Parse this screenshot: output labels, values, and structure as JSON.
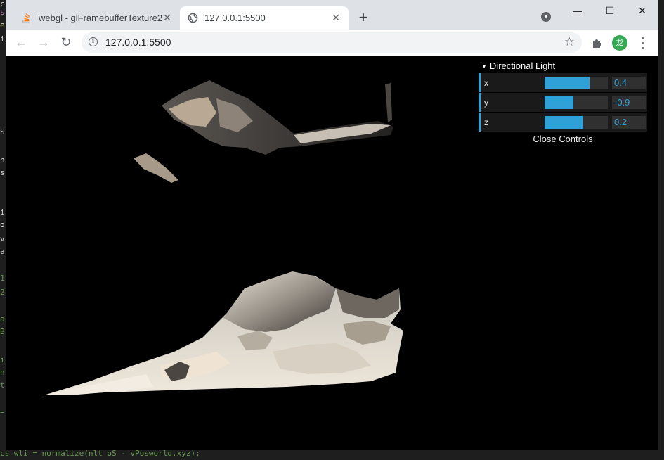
{
  "tabs": [
    {
      "title": "webgl - glFramebufferTexture2",
      "icon": "stack-overflow-icon",
      "active": false
    },
    {
      "title": "127.0.0.1:5500",
      "icon": "globe-icon",
      "active": true
    }
  ],
  "window_controls": {
    "minimize": "—",
    "maximize": "☐",
    "close": "✕"
  },
  "toolbar": {
    "url": "127.0.0.1:5500",
    "profile_initial": "龙"
  },
  "gui": {
    "folder_title": "Directional Light",
    "controls": [
      {
        "label": "x",
        "value": "0.4",
        "fraction": 0.7
      },
      {
        "label": "y",
        "value": "-0.9",
        "fraction": 0.45
      },
      {
        "label": "z",
        "value": "0.2",
        "fraction": 0.6
      }
    ],
    "close_label": "Close Controls"
  },
  "editor_letters": [
    {
      "ch": "c",
      "color": "#d4d4d4"
    },
    {
      "ch": "s",
      "color": "#c586c0"
    },
    {
      "ch": "e",
      "color": "#dcdcaa"
    },
    {
      "ch": "i",
      "color": "#d4d4d4"
    },
    {
      "ch": "S",
      "color": "#d4d4d4"
    },
    {
      "ch": "n",
      "color": "#d4d4d4"
    },
    {
      "ch": "s",
      "color": "#d4d4d4"
    },
    {
      "ch": "i",
      "color": "#d4d4d4"
    },
    {
      "ch": "o",
      "color": "#d4d4d4"
    },
    {
      "ch": "v",
      "color": "#d4d4d4"
    },
    {
      "ch": "a",
      "color": "#d4d4d4"
    },
    {
      "ch": "1",
      "color": "#6a9955"
    },
    {
      "ch": "2",
      "color": "#6a9955"
    },
    {
      "ch": "a",
      "color": "#6a9955"
    },
    {
      "ch": "B",
      "color": "#6a9955"
    },
    {
      "ch": "i",
      "color": "#6a9955"
    },
    {
      "ch": "n",
      "color": "#6a9955"
    },
    {
      "ch": "t",
      "color": "#6a9955"
    },
    {
      "ch": "=",
      "color": "#6a9955"
    }
  ],
  "editor_bottom_line": "cs wli = normalize(nlt oS - vPosworld.xyz);"
}
